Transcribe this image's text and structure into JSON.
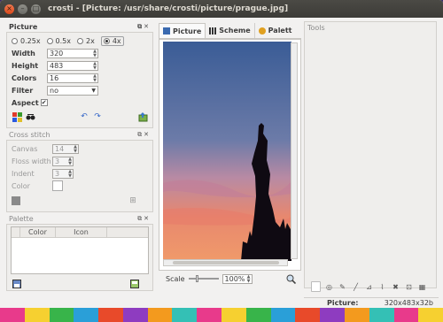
{
  "window": {
    "title": "crosti - [Picture: /usr/share/crosti/picture/prague.jpg]",
    "close_glyph": "×",
    "min_glyph": "–",
    "max_glyph": "□"
  },
  "picture_panel": {
    "title": "Picture",
    "scale_options": [
      "0.25x",
      "0.5x",
      "2x",
      "4x"
    ],
    "selected_scale": "4x",
    "width_label": "Width",
    "width_value": "320",
    "height_label": "Height",
    "height_value": "483",
    "colors_label": "Colors",
    "colors_value": "16",
    "filter_label": "Filter",
    "filter_value": "no",
    "aspect_label": "Aspect",
    "aspect_checked": "✔"
  },
  "cross_stitch_panel": {
    "title": "Cross stitch",
    "canvas_label": "Canvas",
    "canvas_value": "14",
    "floss_label": "Floss width",
    "floss_value": "3",
    "indent_label": "Indent",
    "indent_value": "3",
    "color_label": "Color"
  },
  "palette_panel": {
    "title": "Palette",
    "columns": [
      "Color",
      "Icon"
    ]
  },
  "tabs": [
    {
      "label": "Picture",
      "active": true
    },
    {
      "label": "Scheme",
      "active": false
    },
    {
      "label": "Palett",
      "active": false
    }
  ],
  "scale": {
    "label": "Scale",
    "value": "100%"
  },
  "tools_panel": {
    "title": "Tools"
  },
  "status": {
    "label": "Picture:",
    "value": "320x483x32b"
  },
  "colors": {
    "titlebar": "#3c3b37",
    "window_bg": "#f2f1f0",
    "close_button": "#e2582b"
  },
  "icons": [
    "palette-icon",
    "glasses-icon",
    "undo-icon",
    "redo-icon",
    "export-icon",
    "zoom-icon"
  ]
}
